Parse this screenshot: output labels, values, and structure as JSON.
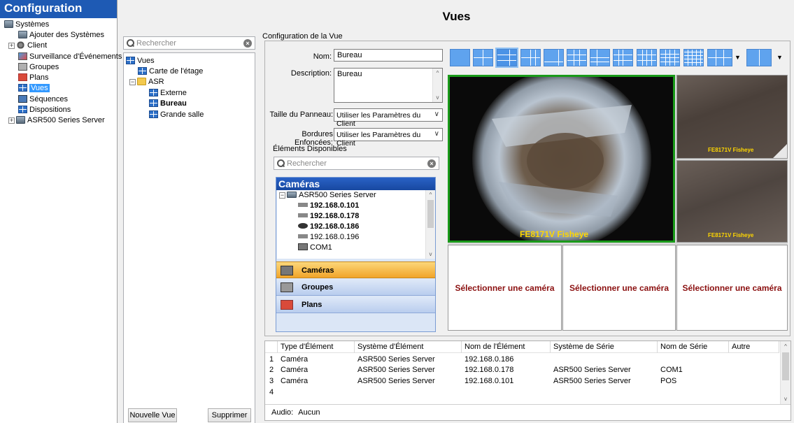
{
  "nav": {
    "title": "Configuration",
    "items": [
      {
        "label": "Systèmes",
        "icon": "server-icon"
      },
      {
        "label": "Ajouter des Systèmes",
        "icon": "add-system-icon"
      },
      {
        "label": "Client",
        "icon": "client-gear-icon"
      },
      {
        "label": "Surveillance d'Événements",
        "icon": "event-monitor-icon"
      },
      {
        "label": "Groupes",
        "icon": "groups-icon"
      },
      {
        "label": "Plans",
        "icon": "plans-icon"
      },
      {
        "label": "Vues",
        "icon": "views-icon"
      },
      {
        "label": "Séquences",
        "icon": "sequences-icon"
      },
      {
        "label": "Dispositions",
        "icon": "layouts-icon"
      },
      {
        "label": "ASR500 Series Server",
        "icon": "server-icon"
      }
    ]
  },
  "views_panel": {
    "search_placeholder": "Rechercher",
    "tree": [
      {
        "label": "Vues"
      },
      {
        "label": "Carte de l'étage"
      },
      {
        "label": "ASR"
      },
      {
        "label": "Externe"
      },
      {
        "label": "Bureau"
      },
      {
        "label": "Grande salle"
      }
    ],
    "new_view_button": "Nouvelle Vue",
    "delete_button": "Supprimer"
  },
  "main": {
    "title": "Vues",
    "config_label": "Configuration de la Vue",
    "name_label": "Nom:",
    "name_value": "Bureau",
    "description_label": "Description:",
    "description_value": "Bureau",
    "panel_size_label": "Taille du Panneau:",
    "panel_size_value": "Utiliser les Paramètres du Client",
    "borders_label": "Bordures Enfoncées:",
    "borders_value": "Utiliser les Paramètres du Client",
    "available_label": "Éléments Disponibles",
    "available_search_placeholder": "Rechercher"
  },
  "available": {
    "header": "Caméras",
    "server": "ASR500 Series Server",
    "items": [
      {
        "label": "192.168.0.101",
        "bold": true
      },
      {
        "label": "192.168.0.178",
        "bold": true
      },
      {
        "label": "192.168.0.186",
        "bold": true
      },
      {
        "label": "192.168.0.196",
        "bold": false
      },
      {
        "label": "COM1",
        "bold": false
      }
    ],
    "categories": [
      "Caméras",
      "Groupes",
      "Plans"
    ]
  },
  "grid": {
    "main_cam_label": "FE8171V Fisheye",
    "side_cam_label_1": "FE8171V Fisheye",
    "side_cam_label_2": "FE8171V Fisheye",
    "select_camera": "Sélectionner une caméra"
  },
  "table": {
    "headers": [
      "Type d'Élément",
      "Système d'Élément",
      "Nom de l'Élément",
      "Système de Série",
      "Nom de Série",
      "Autre"
    ],
    "rows": [
      {
        "num": "1",
        "type": "Caméra",
        "system": "ASR500 Series Server",
        "name": "192.168.0.186",
        "serial_system": "",
        "serial_name": ""
      },
      {
        "num": "2",
        "type": "Caméra",
        "system": "ASR500 Series Server",
        "name": "192.168.0.178",
        "serial_system": "ASR500 Series Server",
        "serial_name": "COM1"
      },
      {
        "num": "3",
        "type": "Caméra",
        "system": "ASR500 Series Server",
        "name": "192.168.0.101",
        "serial_system": "ASR500 Series Server",
        "serial_name": "POS"
      },
      {
        "num": "4",
        "type": "",
        "system": "",
        "name": "",
        "serial_system": "",
        "serial_name": ""
      }
    ],
    "audio_label": "Audio:",
    "audio_value": "Aucun"
  }
}
